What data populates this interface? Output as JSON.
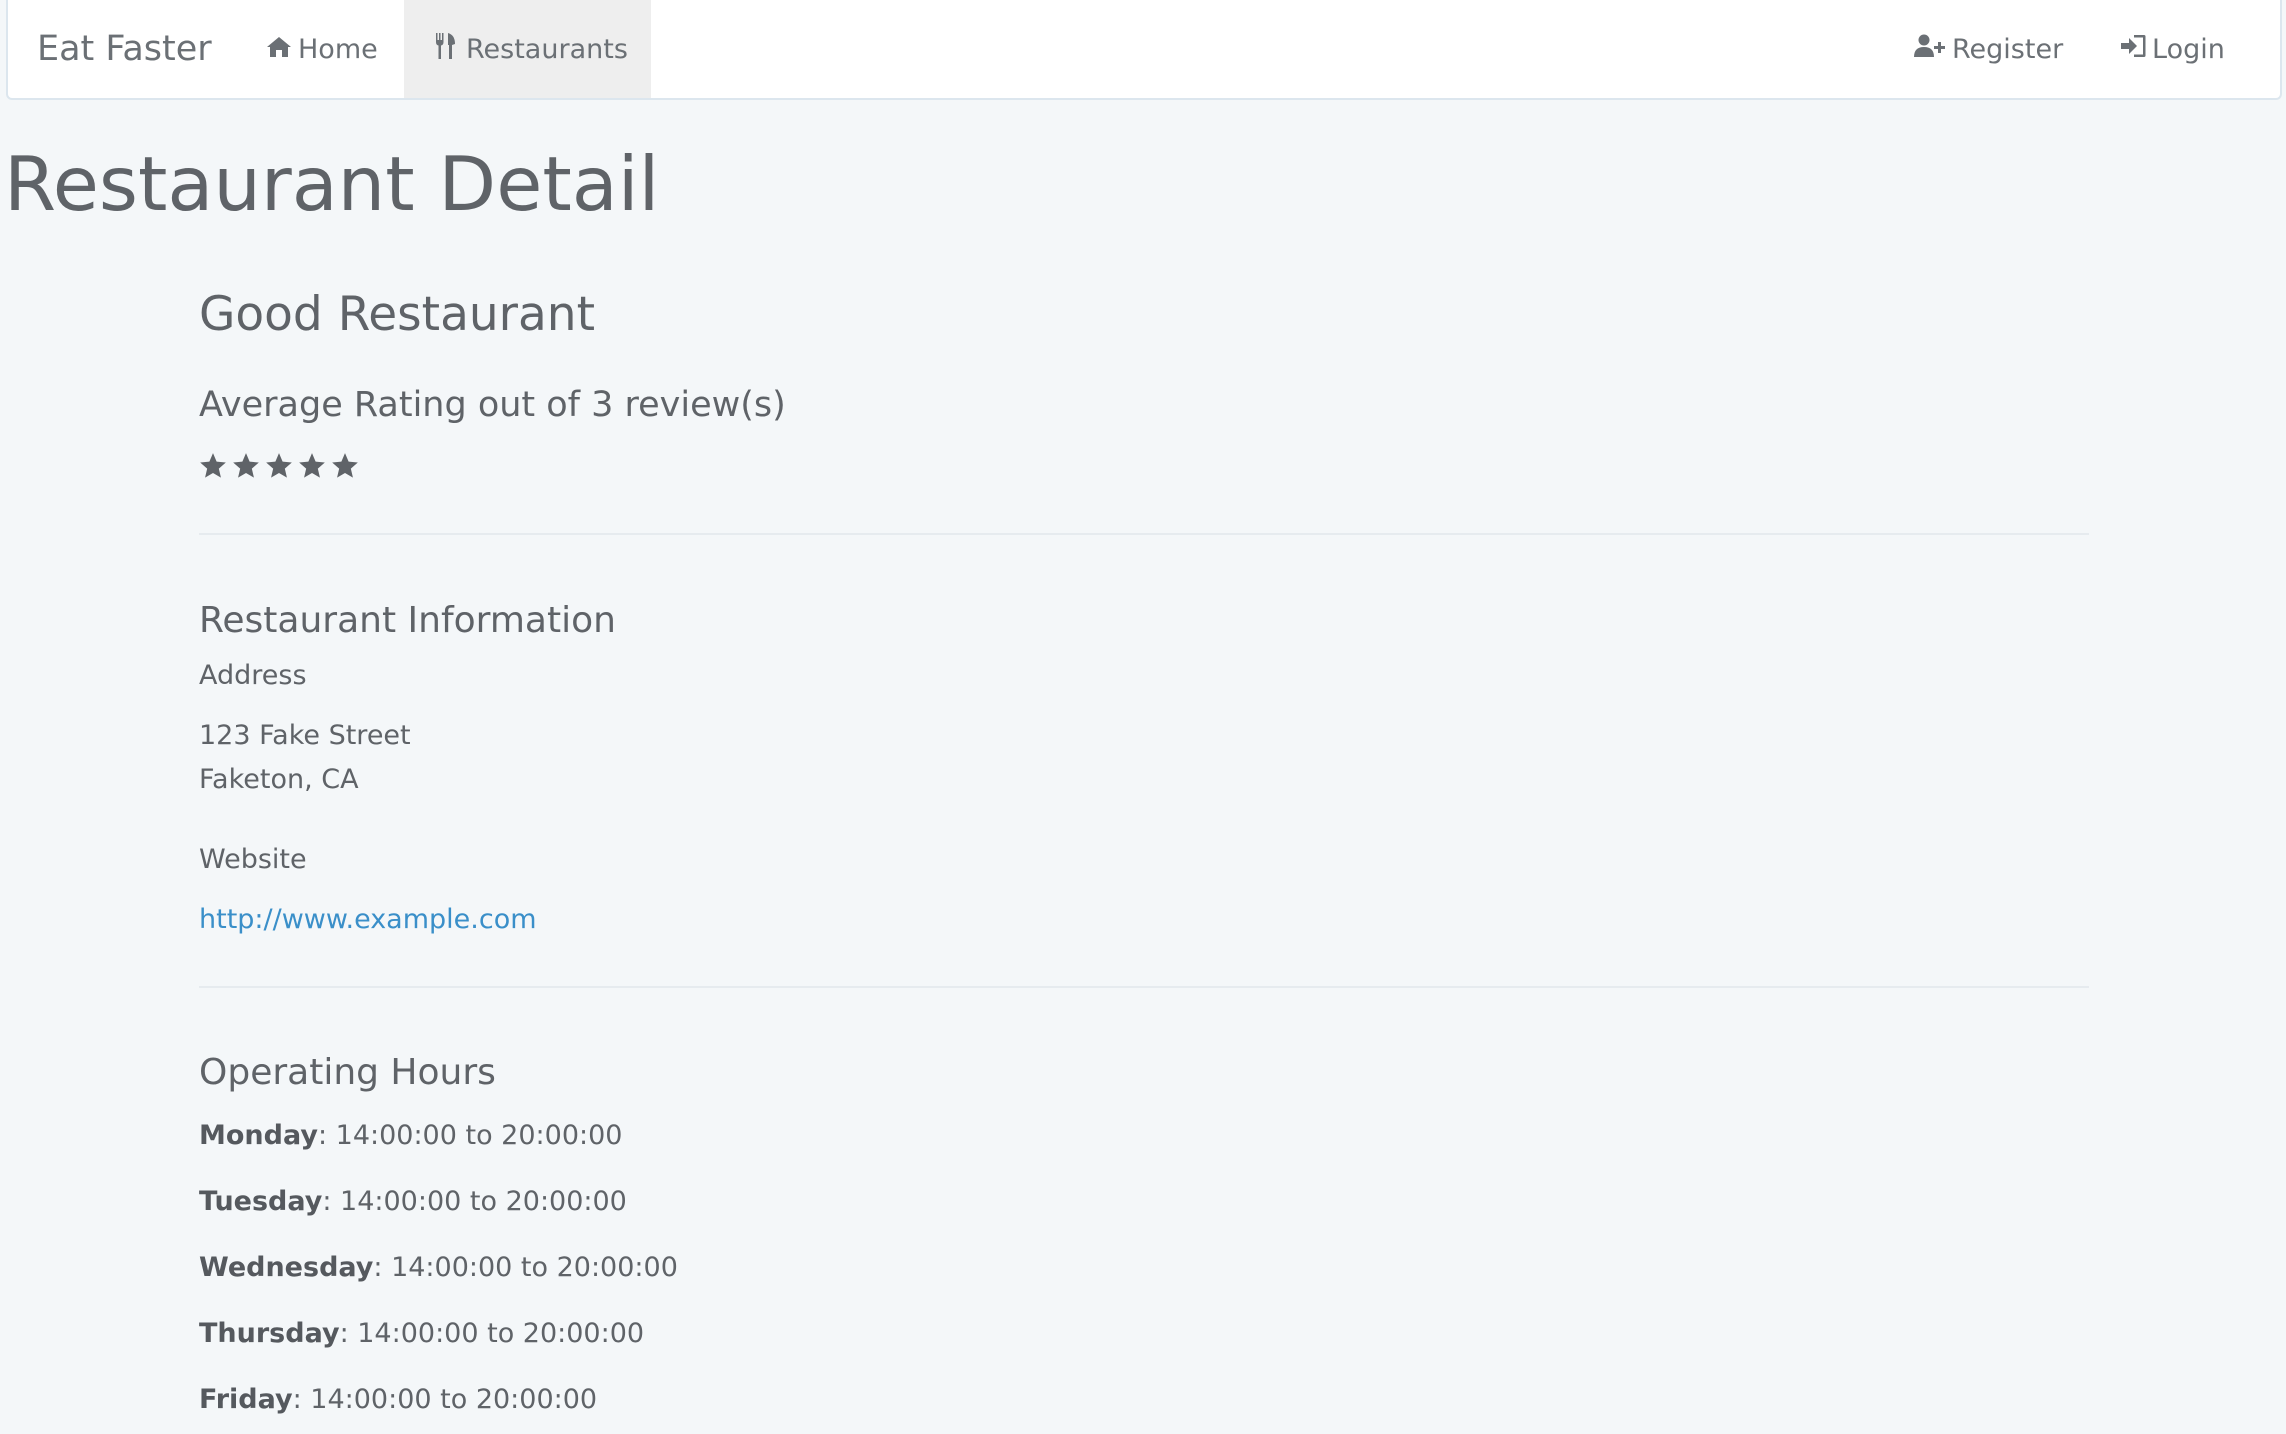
{
  "navbar": {
    "brand": "Eat Faster",
    "home_label": "Home",
    "restaurants_label": "Restaurants",
    "register_label": "Register",
    "login_label": "Login"
  },
  "page": {
    "title": "Restaurant Detail"
  },
  "restaurant": {
    "name": "Good Restaurant",
    "rating_heading": "Average Rating out of 3 review(s)",
    "rating_stars": 5,
    "rating_max": 5
  },
  "info": {
    "heading": "Restaurant Information",
    "address_label": "Address",
    "address_line1": "123 Fake Street",
    "address_line2": "Faketon, CA",
    "website_label": "Website",
    "website_url": "http://www.example.com"
  },
  "hours": {
    "heading": "Operating Hours",
    "days": [
      {
        "day": "Monday",
        "time": ": 14:00:00 to 20:00:00"
      },
      {
        "day": "Tuesday",
        "time": ": 14:00:00 to 20:00:00"
      },
      {
        "day": "Wednesday",
        "time": ": 14:00:00 to 20:00:00"
      },
      {
        "day": "Thursday",
        "time": ": 14:00:00 to 20:00:00"
      },
      {
        "day": "Friday",
        "time": ": 14:00:00 to 20:00:00"
      }
    ]
  },
  "colors": {
    "background": "#f4f7f9",
    "text": "#5f6368",
    "link": "#3a8fc9",
    "nav_active": "#eeeeee"
  },
  "icons": {
    "home": "home-icon",
    "restaurants": "cutlery-icon",
    "register": "user-plus-icon",
    "login": "sign-in-icon",
    "rating": "star-icon"
  }
}
